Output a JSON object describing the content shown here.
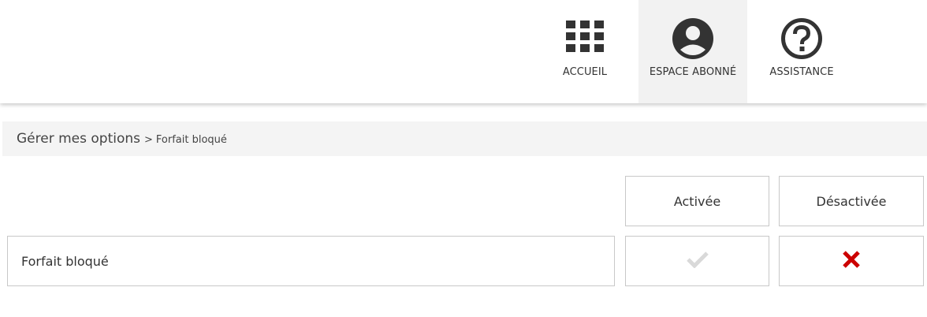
{
  "nav": {
    "items": [
      {
        "label": "ACCUEIL",
        "icon": "grid-icon"
      },
      {
        "label": "ESPACE ABONNÉ",
        "icon": "user-circle-icon"
      },
      {
        "label": "ASSISTANCE",
        "icon": "help-circle-icon"
      }
    ]
  },
  "breadcrumb": {
    "parent": "Gérer mes options",
    "separator": ">",
    "current": "Forfait bloqué"
  },
  "options_table": {
    "columns": [
      "Activée",
      "Désactivée"
    ],
    "rows": [
      {
        "label": "Forfait bloqué",
        "activee": "check-icon",
        "desactivee": "cross-icon",
        "state": "Désactivée"
      }
    ]
  },
  "colors": {
    "icon_dark": "#333333",
    "active_nav_bg": "#f2f2f2",
    "check_inactive": "#d9d9d9",
    "cross_red": "#cc0000"
  }
}
